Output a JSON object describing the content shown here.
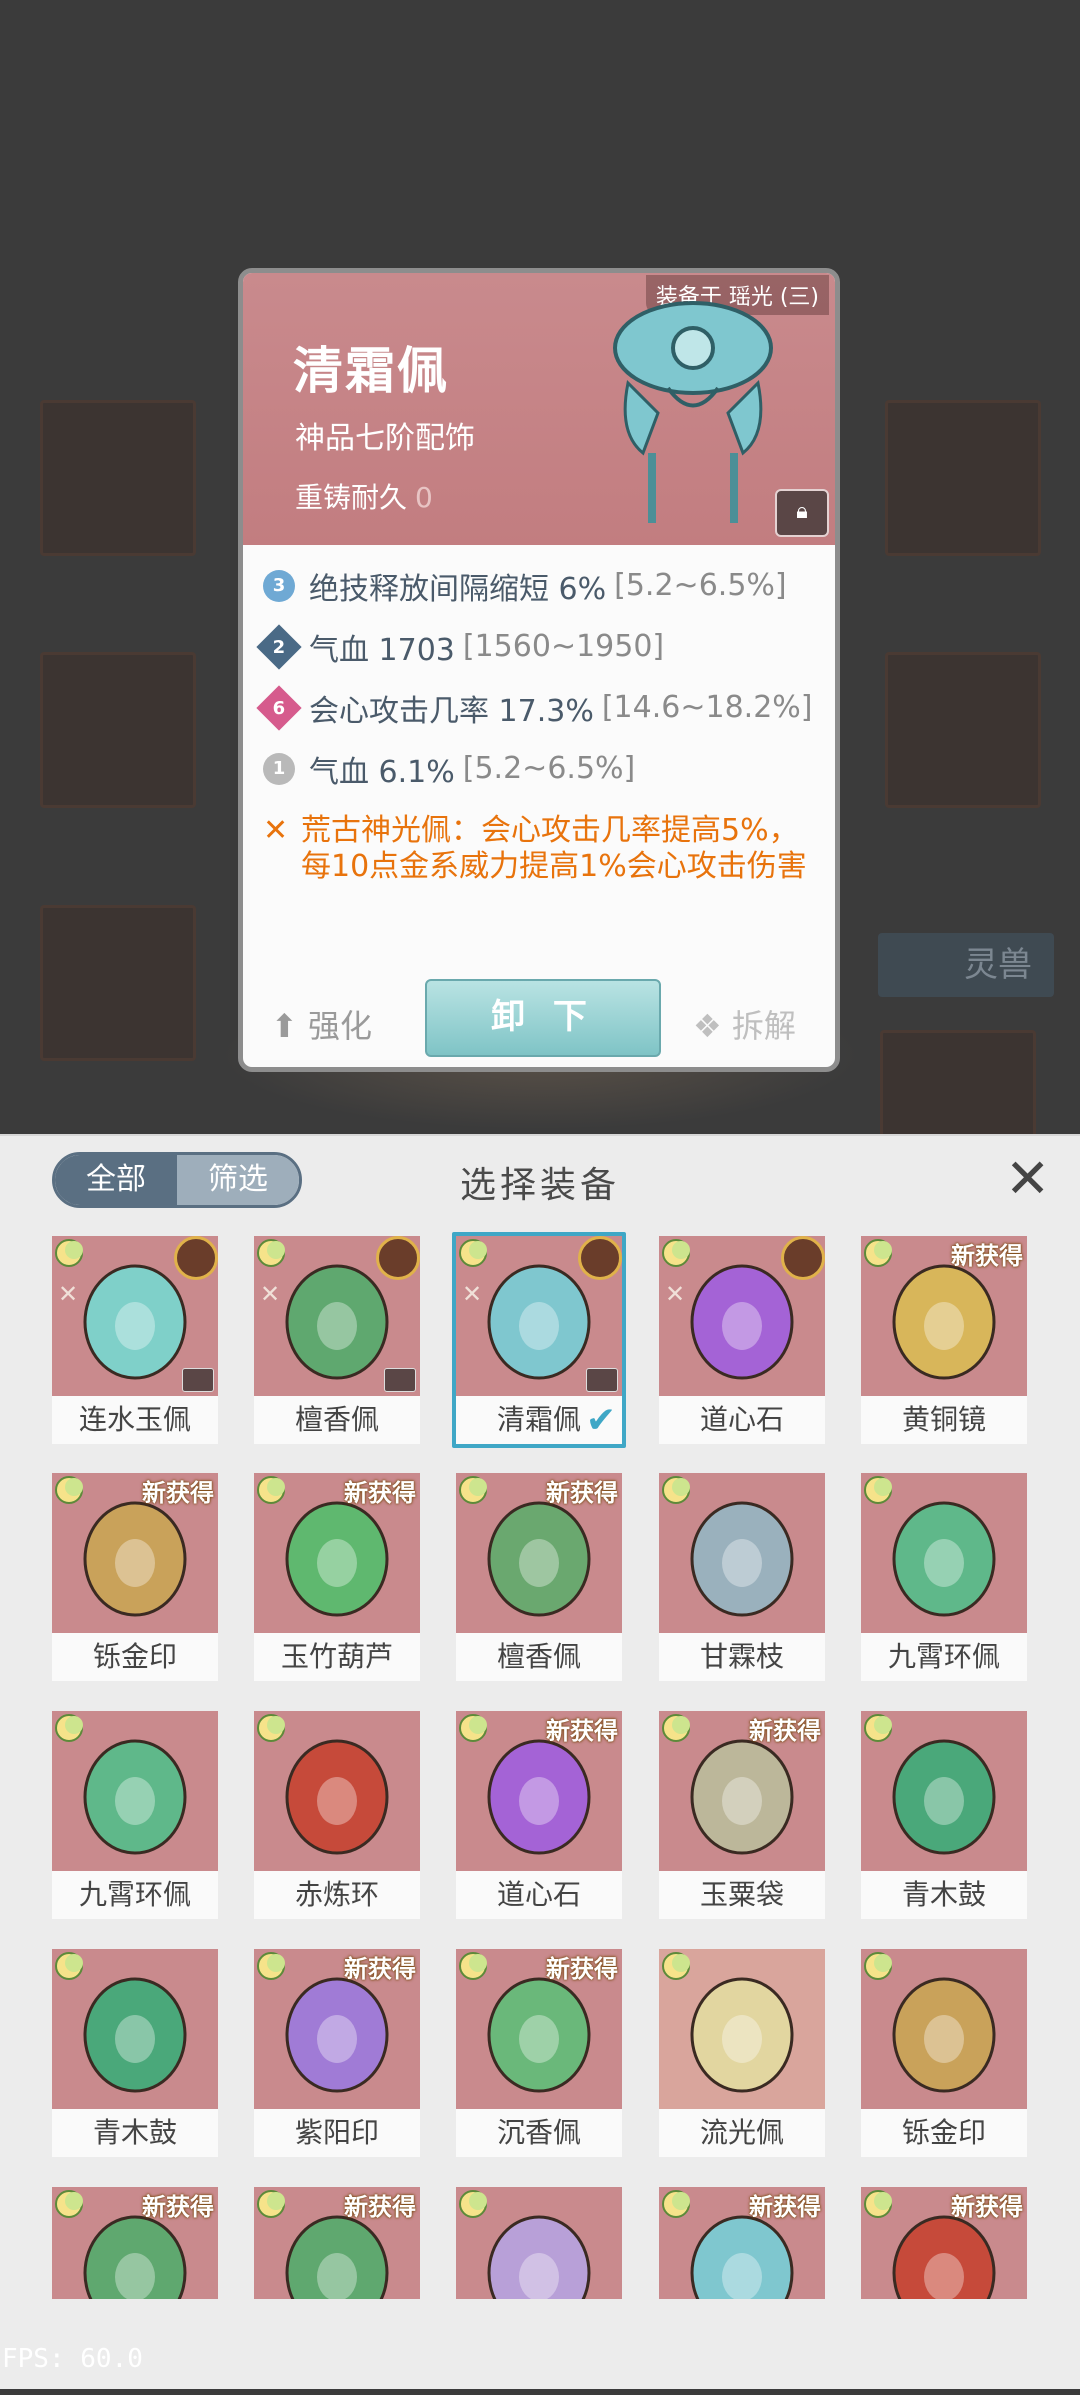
{
  "background": {
    "tag_label": "灵兽"
  },
  "detail_card": {
    "equipped_on": "装备于 瑶光 (三)",
    "name": "清霜佩",
    "grade": "神品七阶配饰",
    "durability_label": "重铸耐久",
    "durability_value": "0",
    "stats": [
      {
        "gem": "3",
        "gem_color": "#6fa9d4",
        "text": "绝技释放间隔缩短 6%",
        "range": "[5.2~6.5%]"
      },
      {
        "gem": "2",
        "gem_color": "#4a6a86",
        "text": "气血 1703",
        "range": "[1560~1950]"
      },
      {
        "gem": "6",
        "gem_color": "#d65b8d",
        "text": "会心攻击几率 17.3%",
        "range": "[14.6~18.2%]"
      },
      {
        "gem": "1",
        "gem_color": "#b9b9b9",
        "text": "气血 6.1%",
        "range": "[5.2~6.5%]"
      }
    ],
    "set_bonus": "荒古神光佩：会心攻击几率提高5%，每10点金系威力提高1%会心攻击伤害",
    "actions": {
      "strengthen": "强化",
      "unequip": "卸 下",
      "dismantle": "拆解"
    }
  },
  "panel": {
    "tabs": [
      "全部",
      "筛选"
    ],
    "title": "选择装备",
    "close_icon": "close-icon",
    "new_badge": "新获得",
    "items": [
      {
        "name": "连水玉佩",
        "badge": "portrait"
      },
      {
        "name": "檀香佩",
        "badge": "portrait"
      },
      {
        "name": "清霜佩",
        "badge": "portrait",
        "selected": true
      },
      {
        "name": "道心石",
        "badge": "portrait"
      },
      {
        "name": "黄铜镜",
        "badge": "new"
      },
      {
        "name": "铄金印",
        "badge": "new"
      },
      {
        "name": "玉竹葫芦",
        "badge": "new"
      },
      {
        "name": "檀香佩",
        "badge": "new"
      },
      {
        "name": "甘霖枝",
        "badge": "none"
      },
      {
        "name": "九霄环佩",
        "badge": "none"
      },
      {
        "name": "九霄环佩",
        "badge": "none"
      },
      {
        "name": "赤炼环",
        "badge": "none"
      },
      {
        "name": "道心石",
        "badge": "new"
      },
      {
        "name": "玉粟袋",
        "badge": "new"
      },
      {
        "name": "青木鼓",
        "badge": "none"
      },
      {
        "name": "青木鼓",
        "badge": "none"
      },
      {
        "name": "紫阳印",
        "badge": "new"
      },
      {
        "name": "沉香佩",
        "badge": "new"
      },
      {
        "name": "流光佩",
        "badge": "none"
      },
      {
        "name": "铄金印",
        "badge": "none"
      },
      {
        "name": "",
        "badge": "new"
      },
      {
        "name": "",
        "badge": "new"
      },
      {
        "name": "",
        "badge": "none"
      },
      {
        "name": "",
        "badge": "new"
      },
      {
        "name": "",
        "badge": "new"
      }
    ]
  },
  "fps": "FPS: 60.0"
}
